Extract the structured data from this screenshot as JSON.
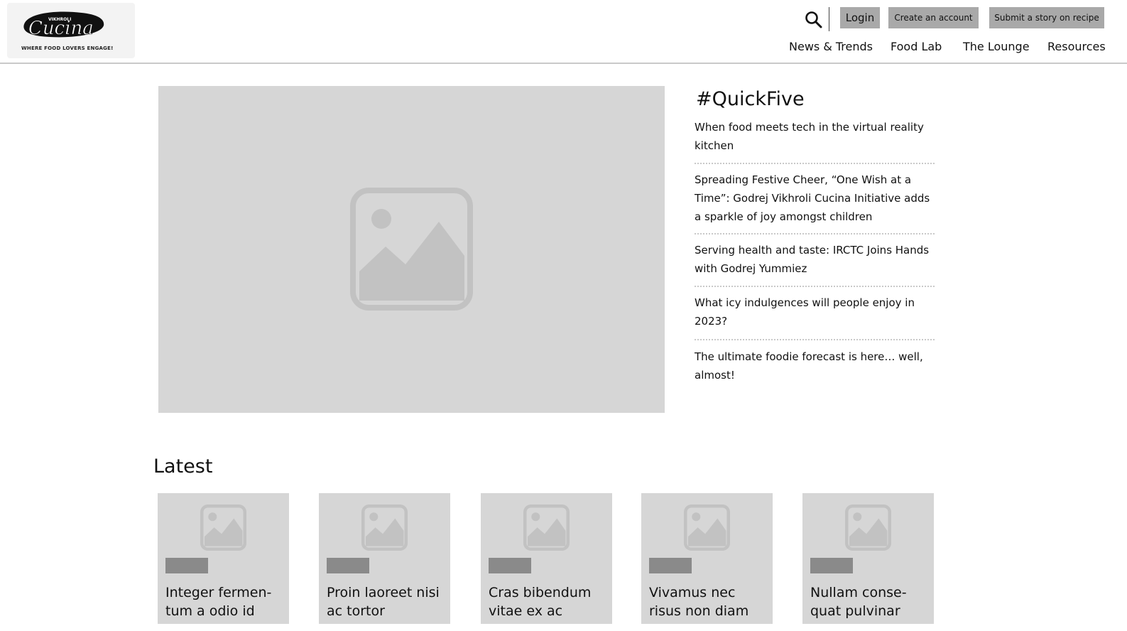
{
  "header": {
    "logo": {
      "top_text": "VIKHROLI",
      "script_text": "Cucina",
      "tagline": "WHERE FOOD LOVERS ENGAGE!"
    },
    "search_icon": "search-icon",
    "buttons": {
      "login": "Login",
      "create_account": "Create an account",
      "submit_story": "Submit a story on recipe"
    },
    "nav": [
      "News & Trends",
      "Food Lab",
      "The Lounge",
      "Resources"
    ]
  },
  "hero": {
    "image_icon": "image-placeholder-icon"
  },
  "quickfive": {
    "title": "#QuickFive",
    "items": [
      "When food meets tech in the virtual reality kitchen",
      "Spreading Festive Cheer, “One Wish at a Time”: Godrej Vikhroli Cucina Initiative adds a sparkle of joy amongst children",
      "Serving health and taste: IRCTC Joins Hands with Godrej Yummiez",
      "What icy indulgences will people enjoy in 2023?",
      "The ultimate foodie forecast is here… well, almost!"
    ]
  },
  "latest": {
    "title": "Latest",
    "cards": [
      {
        "title": "Integer fermen-tum a odio id"
      },
      {
        "title": "Proin laoreet nisi ac tortor"
      },
      {
        "title": "Cras bibendum vitae ex ac"
      },
      {
        "title": "Vivamus nec risus non diam"
      },
      {
        "title": "Nullam conse-quat pulvinar"
      }
    ]
  },
  "colors": {
    "placeholder_bg": "#d6d6d6",
    "placeholder_icon": "#c2c2c2",
    "button_bg": "#a9a9a9",
    "tag_bg": "#8a8a8a"
  }
}
